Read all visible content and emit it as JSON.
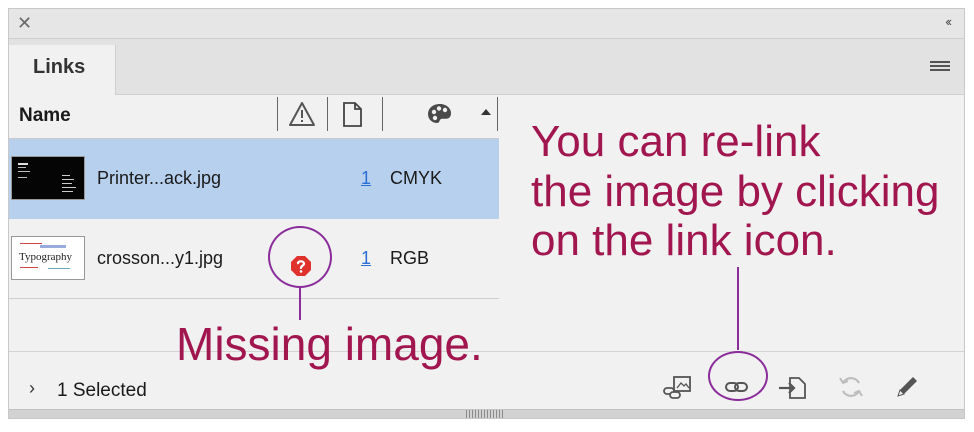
{
  "panel": {
    "tab_label": "Links",
    "column_name": "Name",
    "icons": {
      "close": "close-icon",
      "collapse": "double-chevron-left-icon",
      "menu": "panel-menu-icon",
      "warning": "warning-icon",
      "page": "page-icon",
      "color_space": "palette-icon",
      "sort": "sort-ascending-icon"
    }
  },
  "rows": [
    {
      "filename": "Printer...ack.jpg",
      "page": "1",
      "color_space": "CMYK",
      "selected": true
    },
    {
      "filename": "crosson...y1.jpg",
      "page": "1",
      "color_space": "RGB",
      "selected": false,
      "status": "missing"
    }
  ],
  "thumb_text": "Typography",
  "footer": {
    "selected_text": "1 Selected",
    "icons": [
      "relink-from-cc-icon",
      "relink-icon",
      "go-to-link-icon",
      "update-link-icon",
      "edit-original-icon"
    ]
  },
  "annotations": {
    "relink": "You can re-link\nthe image by clicking\non the link icon.",
    "missing": "Missing image."
  },
  "colors": {
    "annotation_text": "#a1164e",
    "callout_line": "#8a2d9a",
    "selected_row": "#b7d0ee",
    "link_number": "#2b6fd6",
    "missing_badge": "#e0322d"
  }
}
